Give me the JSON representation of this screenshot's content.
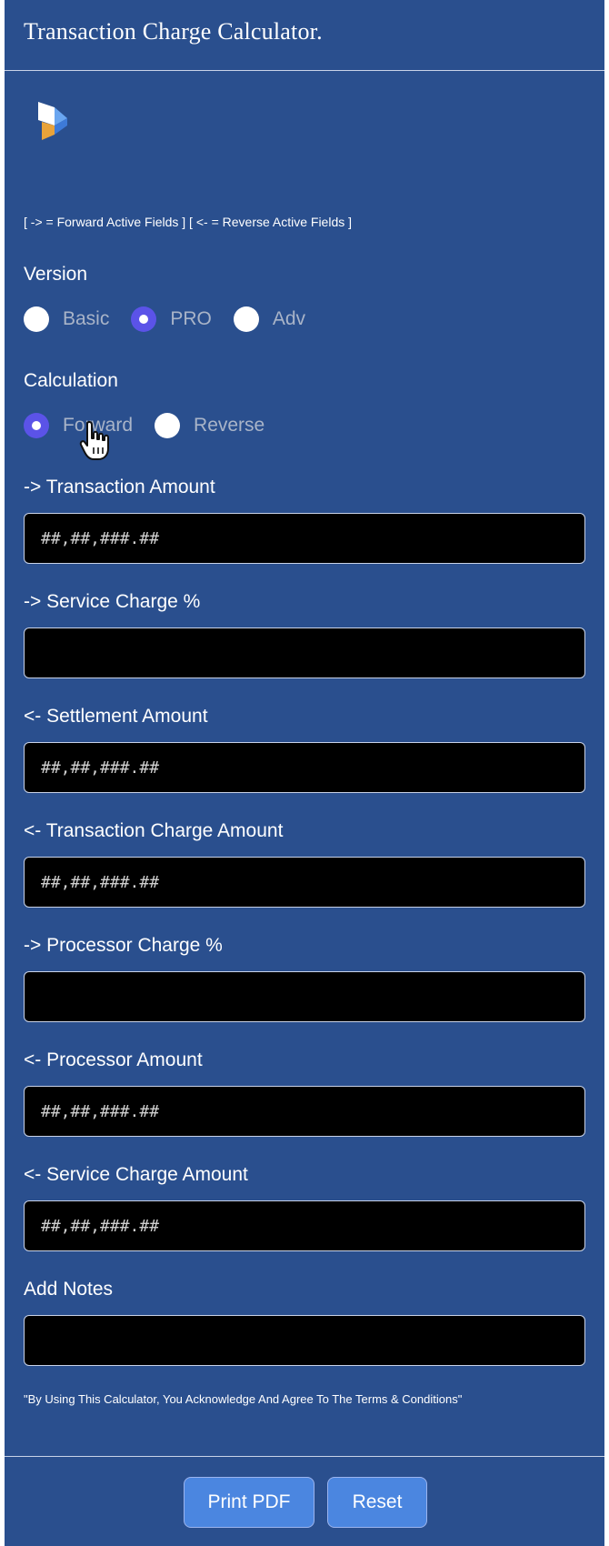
{
  "colors": {
    "bg": "#2a4f8e",
    "accent": "#5b53e8",
    "button": "#4b86e0",
    "muted": "#a9b4c8"
  },
  "header": {
    "title": "Transaction Charge Calculator."
  },
  "hint": "[ -> = Forward Active Fields ] [ <- = Reverse Active Fields ]",
  "version": {
    "label": "Version",
    "options": [
      {
        "label": "Basic",
        "checked": false
      },
      {
        "label": "PRO",
        "checked": true
      },
      {
        "label": "Adv",
        "checked": false
      }
    ]
  },
  "calculation": {
    "label": "Calculation",
    "options": [
      {
        "label": "Forward",
        "checked": true
      },
      {
        "label": "Reverse",
        "checked": false
      }
    ]
  },
  "fields": [
    {
      "label": "-> Transaction Amount",
      "placeholder": "##,##,###.##"
    },
    {
      "label": "-> Service Charge %",
      "placeholder": ""
    },
    {
      "label": "<- Settlement Amount",
      "placeholder": "##,##,###.##"
    },
    {
      "label": "<- Transaction Charge Amount",
      "placeholder": "##,##,###.##"
    },
    {
      "label": "-> Processor Charge %",
      "placeholder": ""
    },
    {
      "label": "<- Processor Amount",
      "placeholder": "##,##,###.##"
    },
    {
      "label": "<- Service Charge Amount",
      "placeholder": "##,##,###.##"
    },
    {
      "label": "Add Notes",
      "placeholder": ""
    }
  ],
  "disclaimer": "\"By Using This Calculator, You Acknowledge And Agree To The Terms & Conditions\"",
  "buttons": {
    "print": "Print PDF",
    "reset": "Reset"
  },
  "icons": {
    "logo": "app-logo-icon",
    "cursor": "hand-pointer-cursor-icon"
  }
}
